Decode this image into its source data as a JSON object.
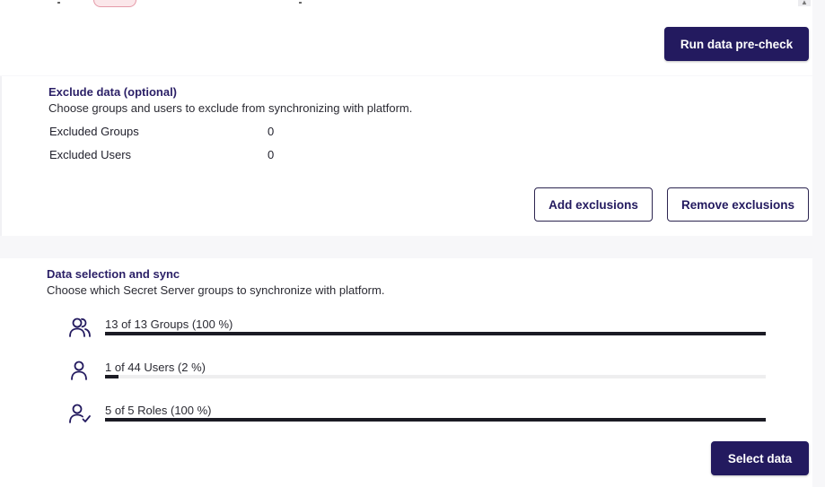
{
  "header": {
    "run_precheck_label": "Run data pre-check"
  },
  "exclude": {
    "title": "Exclude data (optional)",
    "description": "Choose groups and users to exclude from synchronizing with platform.",
    "rows": [
      {
        "label": "Excluded Groups",
        "value": "0"
      },
      {
        "label": "Excluded Users",
        "value": "0"
      }
    ],
    "add_label": "Add exclusions",
    "remove_label": "Remove exclusions"
  },
  "sync": {
    "title": "Data selection and sync",
    "description": "Choose which Secret Server groups to synchronize with platform.",
    "items": [
      {
        "icon": "groups-icon",
        "label": "13 of 13 Groups (100 %)",
        "progress": 1.0
      },
      {
        "icon": "user-icon",
        "label": "1 of 44 Users (2 %)",
        "progress": 0.02
      },
      {
        "icon": "roles-icon",
        "label": "5 of 5 Roles (100 %)",
        "progress": 1.0
      }
    ],
    "select_label": "Select data"
  }
}
